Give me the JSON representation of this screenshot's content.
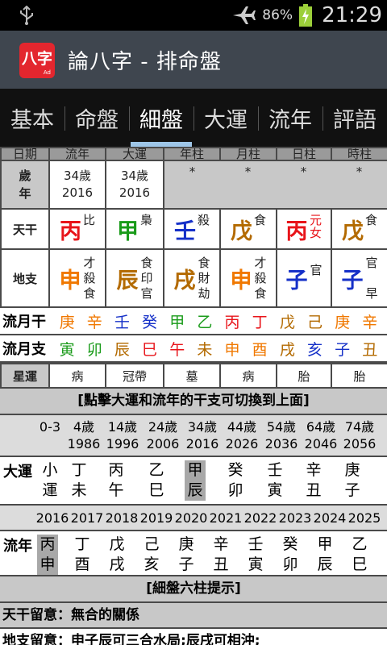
{
  "status": {
    "battery": "86%",
    "time": "21:29"
  },
  "app": {
    "logo": "八字",
    "logo_sub": "Ad",
    "title": "論八字 - 排命盤"
  },
  "tabs": [
    {
      "label": "基本"
    },
    {
      "label": "命盤"
    },
    {
      "label": "細盤",
      "active": true
    },
    {
      "label": "大運"
    },
    {
      "label": "流年"
    },
    {
      "label": "評語"
    }
  ],
  "table": {
    "headers": [
      "日期",
      "流年",
      "大運",
      "年柱",
      "月柱",
      "日柱",
      "時柱"
    ],
    "age_label": "歲年",
    "age": {
      "liunian_age": "34歲",
      "liunian_year": "2016",
      "dayun_age": "34歲",
      "dayun_year": "2016",
      "pillars": [
        "*",
        "*",
        "*",
        "*"
      ]
    },
    "tiangan_label": "天干",
    "tiangan": [
      {
        "char": "丙",
        "tag": "比"
      },
      {
        "char": "甲",
        "tag": "梟"
      },
      {
        "char": "壬",
        "tag": "殺"
      },
      {
        "char": "戊",
        "tag": "食"
      },
      {
        "char": "丙",
        "tag": "元女"
      },
      {
        "char": "戊",
        "tag": "食"
      }
    ],
    "dizhi_label": "地支",
    "dizhi": [
      {
        "char": "申",
        "tags": [
          "才",
          "殺",
          "食"
        ]
      },
      {
        "char": "辰",
        "tags": [
          "食",
          "印",
          "官"
        ]
      },
      {
        "char": "戌",
        "tags": [
          "食",
          "財",
          "劫"
        ]
      },
      {
        "char": "申",
        "tags": [
          "才",
          "殺",
          "食"
        ]
      },
      {
        "char": "子",
        "tags": [
          "官"
        ]
      },
      {
        "char": "子",
        "tags": [
          "官",
          "早"
        ]
      }
    ],
    "xingyun_label": "星運",
    "xingyun": [
      "病",
      "冠帶",
      "墓",
      "病",
      "胎",
      "胎"
    ]
  },
  "liuyue": {
    "gan_label": "流月干",
    "gan": [
      "庚",
      "辛",
      "壬",
      "癸",
      "甲",
      "乙",
      "丙",
      "丁",
      "戊",
      "己",
      "庚",
      "辛"
    ],
    "zhi_label": "流月支",
    "zhi": [
      "寅",
      "卯",
      "辰",
      "巳",
      "午",
      "未",
      "申",
      "酉",
      "戌",
      "亥",
      "子",
      "丑"
    ]
  },
  "banner1": "[點擊大運和流年的干支可切換到上面]",
  "dayun": {
    "ages": [
      "0-3",
      "4歲",
      "14歲",
      "24歲",
      "34歲",
      "44歲",
      "54歲",
      "64歲",
      "74歲"
    ],
    "years": [
      "",
      "1986",
      "1996",
      "2006",
      "2016",
      "2026",
      "2036",
      "2046",
      "2056"
    ],
    "label": "大運",
    "gan": [
      "小",
      "丁",
      "丙",
      "乙",
      "甲",
      "癸",
      "壬",
      "辛",
      "庚"
    ],
    "zhi": [
      "運",
      "未",
      "午",
      "巳",
      "辰",
      "卯",
      "寅",
      "丑",
      "子"
    ]
  },
  "liunian": {
    "years": [
      "2016",
      "2017",
      "2018",
      "2019",
      "2020",
      "2021",
      "2022",
      "2023",
      "2024",
      "2025"
    ],
    "label": "流年",
    "gan": [
      "丙",
      "丁",
      "戊",
      "己",
      "庚",
      "辛",
      "壬",
      "癸",
      "甲",
      "乙"
    ],
    "zhi": [
      "申",
      "酉",
      "戌",
      "亥",
      "子",
      "丑",
      "寅",
      "卯",
      "辰",
      "巳"
    ]
  },
  "banner2": "[細盤六柱提示]",
  "notes": [
    "天干留意：無合的關係",
    "地支留意：申子辰可三合水局;辰戌可相沖;"
  ],
  "colors": {
    "fire": "#e8141a",
    "wood": "#1a9b1a",
    "water": "#1530c8",
    "earth": "#b36a00",
    "metal": "#f07800"
  }
}
